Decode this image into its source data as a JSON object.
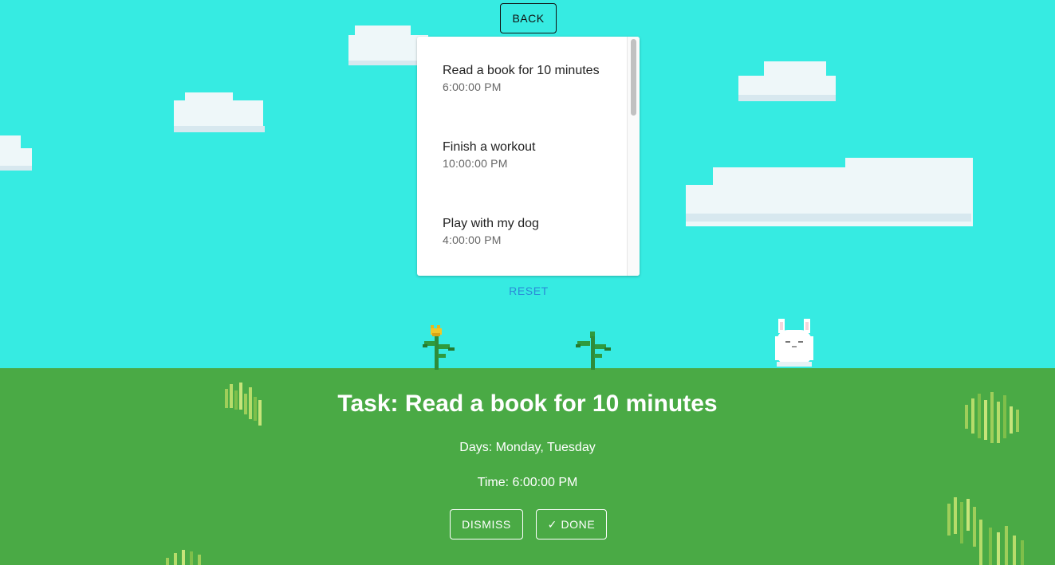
{
  "header": {
    "back_label": "BACK"
  },
  "tasks": [
    {
      "title": "Read a book for 10 minutes",
      "time": "6:00:00 PM"
    },
    {
      "title": "Finish a workout",
      "time": "10:00:00 PM"
    },
    {
      "title": "Play with my dog",
      "time": "4:00:00 PM"
    }
  ],
  "reset_label": "RESET",
  "detail": {
    "title": "Task: Read a book for 10 minutes",
    "days": "Days: Monday, Tuesday",
    "time": "Time: 6:00:00 PM",
    "dismiss_label": "DISMISS",
    "done_label": "✓ DONE"
  },
  "icons": {
    "plant": "sprout-icon",
    "flower": "tulip-sprout-icon",
    "pet": "bunny-pet-icon",
    "grass": "grass-tuft-icon",
    "cloud": "cloud-icon"
  },
  "colors": {
    "sky": "#36ebe2",
    "ground": "#4aaa45",
    "accent": "#2b8ad8"
  }
}
